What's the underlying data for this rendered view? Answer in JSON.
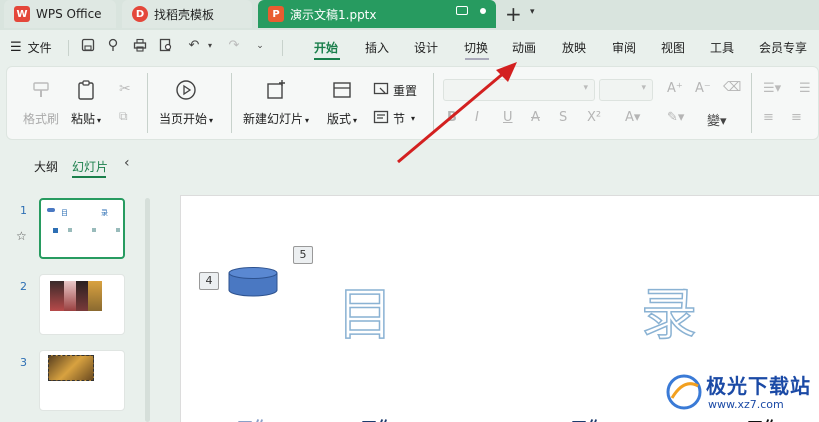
{
  "titlebar": {
    "tabs": [
      {
        "label": "WPS Office",
        "icon": "wps-logo-icon"
      },
      {
        "label": "找稻壳模板",
        "icon": "docer-icon"
      },
      {
        "label": "演示文稿1.pptx",
        "icon": "presentation-file-icon",
        "active": true
      }
    ],
    "new_tab": "+"
  },
  "menubar": {
    "file_label": "文件",
    "ribbon_tabs": [
      "开始",
      "插入",
      "设计",
      "切换",
      "动画",
      "放映",
      "审阅",
      "视图",
      "工具",
      "会员专享"
    ],
    "active_tab": "开始"
  },
  "ribbon": {
    "format_painter": "格式刷",
    "paste": "粘贴",
    "play_from_current": "当页开始",
    "new_slide": "新建幻灯片",
    "layout": "版式",
    "reset": "重置",
    "section": "节"
  },
  "left_panel": {
    "tabs": [
      "大纲",
      "幻灯片"
    ],
    "active_tab": "幻灯片",
    "slides": [
      {
        "number": "1",
        "title_left": "目",
        "title_right": "录"
      },
      {
        "number": "2"
      },
      {
        "number": "3"
      }
    ]
  },
  "slide": {
    "tag_4": "4",
    "tag_5": "5",
    "char_left": "目",
    "char_right": "录",
    "bottom_fragments": [
      "工作",
      "工作",
      "工作",
      "工作"
    ]
  },
  "watermark": {
    "title": "极光下载站",
    "url": "www.xz7.com"
  },
  "colors": {
    "accent": "#279b60",
    "arrow": "#d32020",
    "outline_text": "#8ab2d3",
    "shape": "#4a78c2"
  }
}
